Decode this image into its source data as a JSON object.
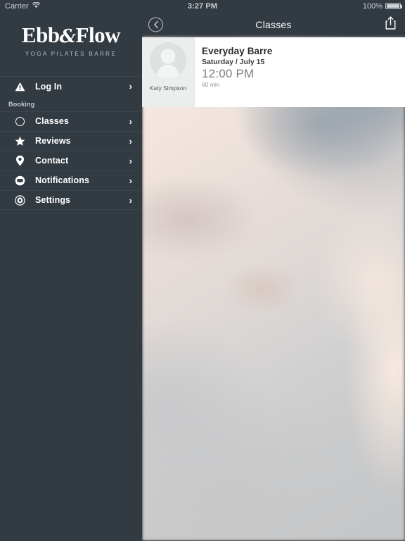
{
  "status_bar": {
    "carrier": "Carrier",
    "wifi_icon": "wifi-icon",
    "time": "3:27 PM",
    "battery_percent": "100%",
    "battery_icon": "battery-full-icon"
  },
  "sidebar": {
    "logo": {
      "part1": "Ebb",
      "ampersand": "&",
      "part2": "Flow",
      "tagline": "YOGA  PILATES  BARRE"
    },
    "account": {
      "label": "Log In",
      "icon": "warning-triangle-icon",
      "chevron": "›"
    },
    "section_label": "Booking",
    "items": [
      {
        "label": "Classes",
        "icon": "circle-icon",
        "chevron": "›"
      },
      {
        "label": "Reviews",
        "icon": "star-icon",
        "chevron": "›"
      },
      {
        "label": "Contact",
        "icon": "location-pin-icon",
        "chevron": "›"
      },
      {
        "label": "Notifications",
        "icon": "speech-bubble-icon",
        "chevron": "›"
      },
      {
        "label": "Settings",
        "icon": "gear-target-icon",
        "chevron": "›"
      }
    ]
  },
  "navbar": {
    "title": "Classes",
    "back_icon": "back-chevron-circle-icon",
    "share_icon": "share-icon"
  },
  "class_card": {
    "instructor_name": "Katy Simpson",
    "avatar_icon": "person-placeholder-icon",
    "title": "Everyday Barre",
    "date": "Saturday / July 15",
    "time": "12:00 PM",
    "duration": "60 min"
  },
  "colors": {
    "sidebar_bg": "#323a42",
    "navbar_bg": "#323a42",
    "card_bg": "#ffffff",
    "text_light": "#ffffff",
    "avatar_bg": "#dfe0e1"
  }
}
